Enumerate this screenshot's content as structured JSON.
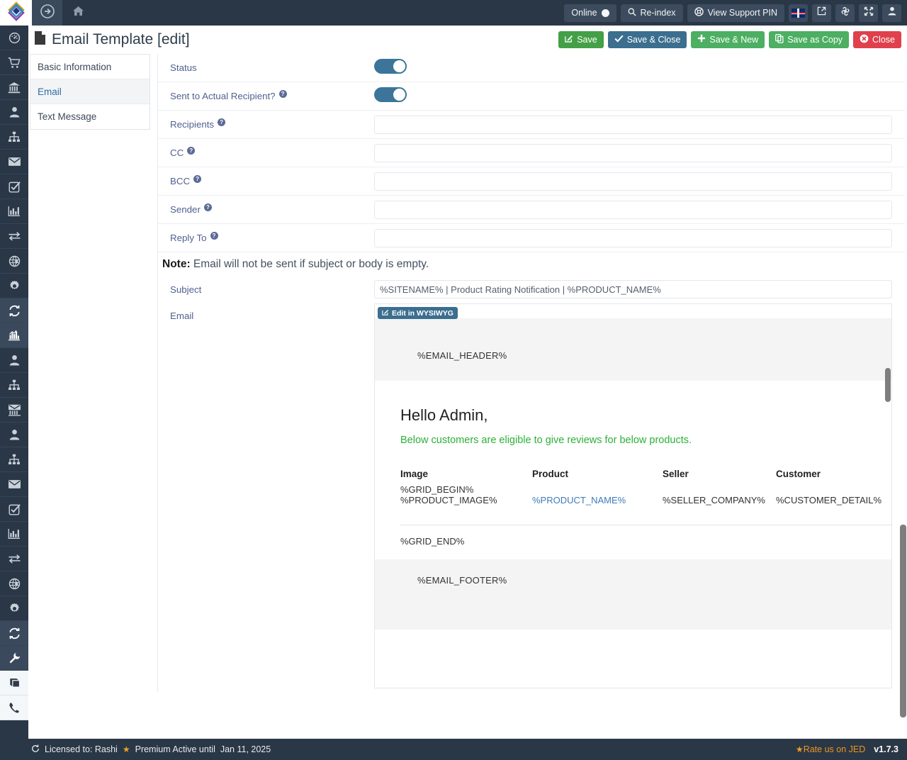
{
  "topbar": {
    "logo_icon": "diamond-logo-icon",
    "nav_arrow_icon": "arrow-circle-right-icon",
    "home_icon": "home-icon",
    "online_label": "Online",
    "reindex_label": "Re-index",
    "support_pin_label": "View Support PIN",
    "search_icon": "search-icon",
    "lifebuoy_icon": "lifebuoy-icon",
    "flag_icon": "uk-flag-icon",
    "preview_icon": "external-link-icon",
    "joomla_icon": "joomla-icon",
    "fullscreen_icon": "expand-arrows-icon",
    "user_icon": "user-icon"
  },
  "header": {
    "doc_icon": "file-icon",
    "title": "Email Template [edit]",
    "buttons": [
      {
        "label": "Save",
        "icon": "pencil-square-icon",
        "style": "green"
      },
      {
        "label": "Save & Close",
        "icon": "check-icon",
        "style": "blue"
      },
      {
        "label": "Save & New",
        "icon": "plus-icon",
        "style": "green2"
      },
      {
        "label": "Save as Copy",
        "icon": "copy-icon",
        "style": "green3"
      },
      {
        "label": "Close",
        "icon": "times-circle-icon",
        "style": "red"
      }
    ]
  },
  "tabs": [
    {
      "label": "Basic Information",
      "active": false
    },
    {
      "label": "Email",
      "active": true
    },
    {
      "label": "Text Message",
      "active": false
    }
  ],
  "form": {
    "status": {
      "label": "Status",
      "value": "on",
      "has_help": false
    },
    "sent_to_actual_recipient": {
      "label": "Sent to Actual Recipient?",
      "value": "on",
      "has_help": true
    },
    "recipients": {
      "label": "Recipients",
      "value": "",
      "placeholder": "",
      "has_help": true
    },
    "cc": {
      "label": "CC",
      "value": "",
      "placeholder": "",
      "has_help": true
    },
    "bcc": {
      "label": "BCC",
      "value": "",
      "placeholder": "",
      "has_help": true
    },
    "sender": {
      "label": "Sender",
      "value": "",
      "placeholder": "",
      "has_help": true
    },
    "reply_to": {
      "label": "Reply To",
      "value": "",
      "placeholder": "",
      "has_help": true
    },
    "note_bold": "Note:",
    "note_text": " Email will not be sent if subject or body is empty.",
    "subject": {
      "label": "Subject",
      "value": "%SITENAME% | Product Rating Notification | %PRODUCT_NAME%",
      "placeholder": ""
    },
    "email": {
      "label": "Email",
      "wysiwyg_button": "Edit in WYSIWYG",
      "wysiwyg_icon": "pencil-square-icon"
    }
  },
  "email_preview": {
    "header_token": "%EMAIL_HEADER%",
    "greeting": "Hello Admin,",
    "subline": "Below customers are eligible to give reviews for below products.",
    "table": {
      "headers": [
        "Image",
        "Product",
        "Seller",
        "Customer"
      ],
      "grid_begin": "%GRID_BEGIN%",
      "row": [
        "%PRODUCT_IMAGE%",
        "%PRODUCT_NAME%",
        "%SELLER_COMPANY%",
        "%CUSTOMER_DETAIL%"
      ],
      "grid_end": "%GRID_END%"
    },
    "footer_token": "%EMAIL_FOOTER%"
  },
  "rail": {
    "items": [
      {
        "icon": "dashboard-icon",
        "active": false,
        "light": false
      },
      {
        "icon": "cart-icon",
        "active": false,
        "light": false
      },
      {
        "icon": "bank-icon",
        "active": false,
        "light": false
      },
      {
        "icon": "user-icon",
        "active": false,
        "light": false
      },
      {
        "icon": "sitemap-icon",
        "active": false,
        "light": false
      },
      {
        "icon": "envelope-icon",
        "active": false,
        "light": false
      },
      {
        "icon": "check-square-icon",
        "active": false,
        "light": false
      },
      {
        "icon": "bar-chart-icon",
        "active": false,
        "light": false
      },
      {
        "icon": "exchange-icon",
        "active": false,
        "light": false
      },
      {
        "icon": "globe-icon",
        "active": false,
        "light": false
      },
      {
        "icon": "gear-icon",
        "active": false,
        "light": false
      },
      {
        "icon": "refresh-icon",
        "active": true,
        "light": false
      },
      {
        "icon": "chart-bars-icon",
        "active": true,
        "light": false
      },
      {
        "icon": "user-icon",
        "active": false,
        "light": false
      },
      {
        "icon": "sitemap-icon",
        "active": false,
        "light": false
      },
      {
        "icon": "bank-envelope-icon",
        "active": false,
        "light": false
      },
      {
        "icon": "user-icon",
        "active": false,
        "light": false
      },
      {
        "icon": "sitemap-icon",
        "active": false,
        "light": false
      },
      {
        "icon": "envelope-icon",
        "active": false,
        "light": false
      },
      {
        "icon": "check-square-icon",
        "active": false,
        "light": false
      },
      {
        "icon": "bar-chart-icon",
        "active": false,
        "light": false
      },
      {
        "icon": "exchange-icon",
        "active": false,
        "light": false
      },
      {
        "icon": "globe-icon",
        "active": false,
        "light": false
      },
      {
        "icon": "gear-icon",
        "active": false,
        "light": false
      },
      {
        "icon": "refresh-icon",
        "active": true,
        "light": false
      },
      {
        "icon": "wrench-icon",
        "active": true,
        "light": false
      },
      {
        "icon": "book-icon",
        "active": false,
        "light": true
      },
      {
        "icon": "phone-icon",
        "active": false,
        "light": true
      }
    ]
  },
  "footer": {
    "refresh_icon": "refresh-icon",
    "license_label": "Licensed to: Rashi",
    "star_icon": "star-icon",
    "premium_label": "Premium Active until",
    "premium_date": "Jan 11, 2025",
    "rate_label": "Rate us on JED",
    "version": "v1.7.3"
  },
  "colors": {
    "nav_bg": "#2a3746",
    "accent_blue": "#3b6e8f",
    "green": "#4caf62",
    "red": "#e0404c",
    "label_blue": "#51618f",
    "link_green": "#2bb037",
    "orange": "#f0951f"
  }
}
